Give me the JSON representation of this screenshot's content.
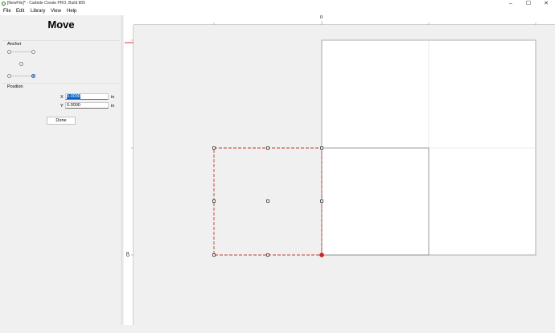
{
  "window": {
    "title": "[NewFile]* - Carbide Create PRO, Build 805",
    "minimize": "–",
    "maximize": "☐",
    "close": "✕"
  },
  "menu": [
    "File",
    "Edit",
    "Library",
    "View",
    "Help"
  ],
  "panel": {
    "title": "Move",
    "anchor_label": "Anchor",
    "anchor_selected": "bottom-right",
    "position_label": "Position",
    "x_label": "X",
    "x_value": "0.0000",
    "y_label": "Y",
    "y_value": "0.0000",
    "unit": "in",
    "done_label": "Done"
  },
  "ruler": {
    "top_zero": "0",
    "left_zero": "0"
  },
  "colors": {
    "selection": "#c0392b",
    "anchor_point": "#d62020",
    "accent": "#0b62c4"
  }
}
